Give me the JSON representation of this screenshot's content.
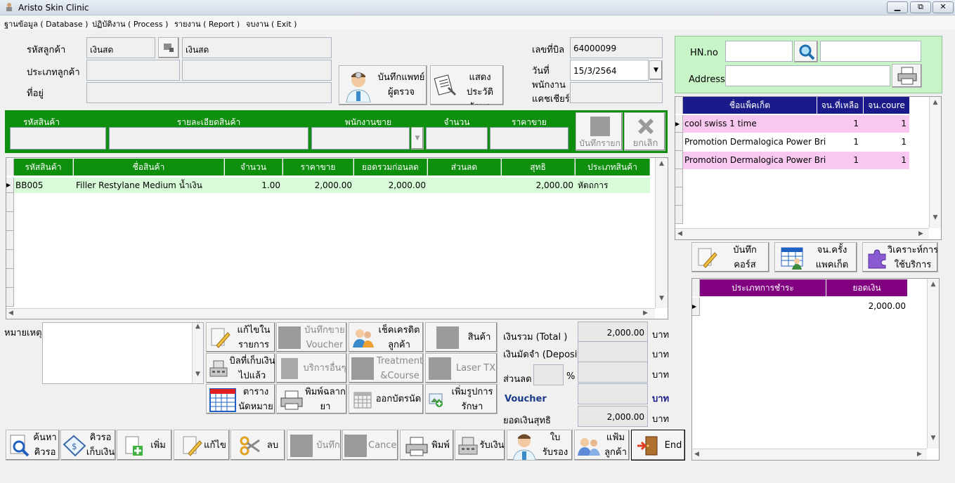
{
  "window": {
    "title": "Aristo Skin Clinic",
    "controls": [
      "▁",
      "⧉",
      "✕"
    ]
  },
  "menu": [
    "ฐานข้อมูล ( Database )",
    "ปฏิบัติงาน ( Process )",
    "รายงาน ( Report )",
    "จบงาน ( Exit )"
  ],
  "customer": {
    "code_label": "รหัสลูกค้า",
    "code_value": "เงินสด",
    "name_value": "เงินสด",
    "type_label": "ประเภทลูกค้า",
    "address_label": "ที่อยู่"
  },
  "actions_top": {
    "doctor_record": "บันทึกแพทย์\nผู้ตรวจ",
    "show_history": "แสดงประวัติ\nรักษา"
  },
  "bill": {
    "no_label": "เลขที่บิล",
    "no_value": "64000099",
    "date_label": "วันที่",
    "date_value": "15/3/2564",
    "cashier_label": "พนักงาน\nแคชเชียร์"
  },
  "entry": {
    "headers": [
      "รหัสสินค้า",
      "รายละเอียดสินค้า",
      "พนักงานขาย",
      "จำนวน",
      "ราคาขาย"
    ],
    "save_item": "บันทึกรายก",
    "cancel": "ยกเลิก"
  },
  "items_table": {
    "columns": [
      "รหัสสินค้า",
      "ชื่อสินค้า",
      "จำนวน",
      "ราคาขาย",
      "ยอดรวมก่อนลด",
      "ส่วนลด",
      "สุทธิ",
      "ประเภทสินค้า"
    ],
    "rows": [
      {
        "code": "BB005",
        "name": "Filler Restylane Medium น้ำเงิน",
        "qty": "1.00",
        "price": "2,000.00",
        "subtotal": "2,000.00",
        "discount": "",
        "net": "2,000.00",
        "type": "หัตถการ"
      }
    ]
  },
  "note_label": "หมายเหตุ",
  "mid_buttons": {
    "edit_item": "แก้ไขใน\nรายการ",
    "save_voucher": "บันทึกขาย\nVoucher",
    "check_credit": "เช็คเครดิต\nลูกค้า",
    "product": "สินค้า",
    "paid_bill": "บิลที่เก็บเงิน\nไปแล้ว",
    "other_service": "บริการอื่นๆ",
    "treatment_course": "Treatment\n&Course",
    "laser": "Laser  TX",
    "schedule": "ตาราง\nนัดหมาย",
    "print_label": "พิมพ์ฉลาก\nยา",
    "appointment_card": "ออกบัตรนัด",
    "add_treatment_image": "เพิ่มรูปการ\nรักษา"
  },
  "totals": {
    "total_label": "เงินรวม (Total )",
    "total_value": "2,000.00",
    "deposit_label": "เงินมัดจำ (Deposit)",
    "deposit_value": "",
    "discount_label": "ส่วนลด",
    "discount_pct_unit": "%",
    "discount_value": "",
    "voucher_label": "Voucher",
    "voucher_value": "",
    "net_label": "ยอดเงินสุทธิ",
    "net_value": "2,000.00",
    "currency": "บาท"
  },
  "bottom_buttons": {
    "search_queue": "ค้นหา\nคิวรอ",
    "queue_payment": "คิวรอ\nเก็บเงิน",
    "add": "เพิ่ม",
    "edit": "แก้ไข",
    "delete": "ลบ",
    "save": "บันทึก",
    "cancel": "Cancel",
    "print": "พิมพ์",
    "receive": "รับเงิน",
    "certificate": "ใบ\nรับรอง",
    "customer_file": "แฟ้ม\nลูกค้า",
    "end": "End"
  },
  "hn_panel": {
    "hn_label": "HN.no",
    "address_label": "Address"
  },
  "packages": {
    "columns": [
      "ชื่อแพ็คเก็ต",
      "จน.ที่เหลือ",
      "จน.coure"
    ],
    "rows": [
      {
        "name": "cool swiss 1 time",
        "left": "1",
        "course": "1"
      },
      {
        "name": "Promotion Dermalogica Power Bri",
        "left": "1",
        "course": "1"
      },
      {
        "name": "Promotion Dermalogica Power Bri",
        "left": "1",
        "course": "1"
      }
    ]
  },
  "right_buttons": {
    "save_course": "บันทึก\nคอร์ส",
    "package_count": "จน.ครั้ง\nแพคเก็ต",
    "analyze_usage": "วิเคราะห์การ\nใช้บริการ"
  },
  "payments": {
    "columns": [
      "ประเภทการชำระ",
      "ยอดเงิน"
    ],
    "rows": [
      {
        "type": "",
        "amount": "2,000.00"
      }
    ]
  },
  "colors": {
    "green_header": "#0e8f0e",
    "navy_header": "#1a1a8a",
    "purple_header": "#800080",
    "pink_row": "#f8c8f0",
    "light_green_row": "#d8fcd8"
  }
}
